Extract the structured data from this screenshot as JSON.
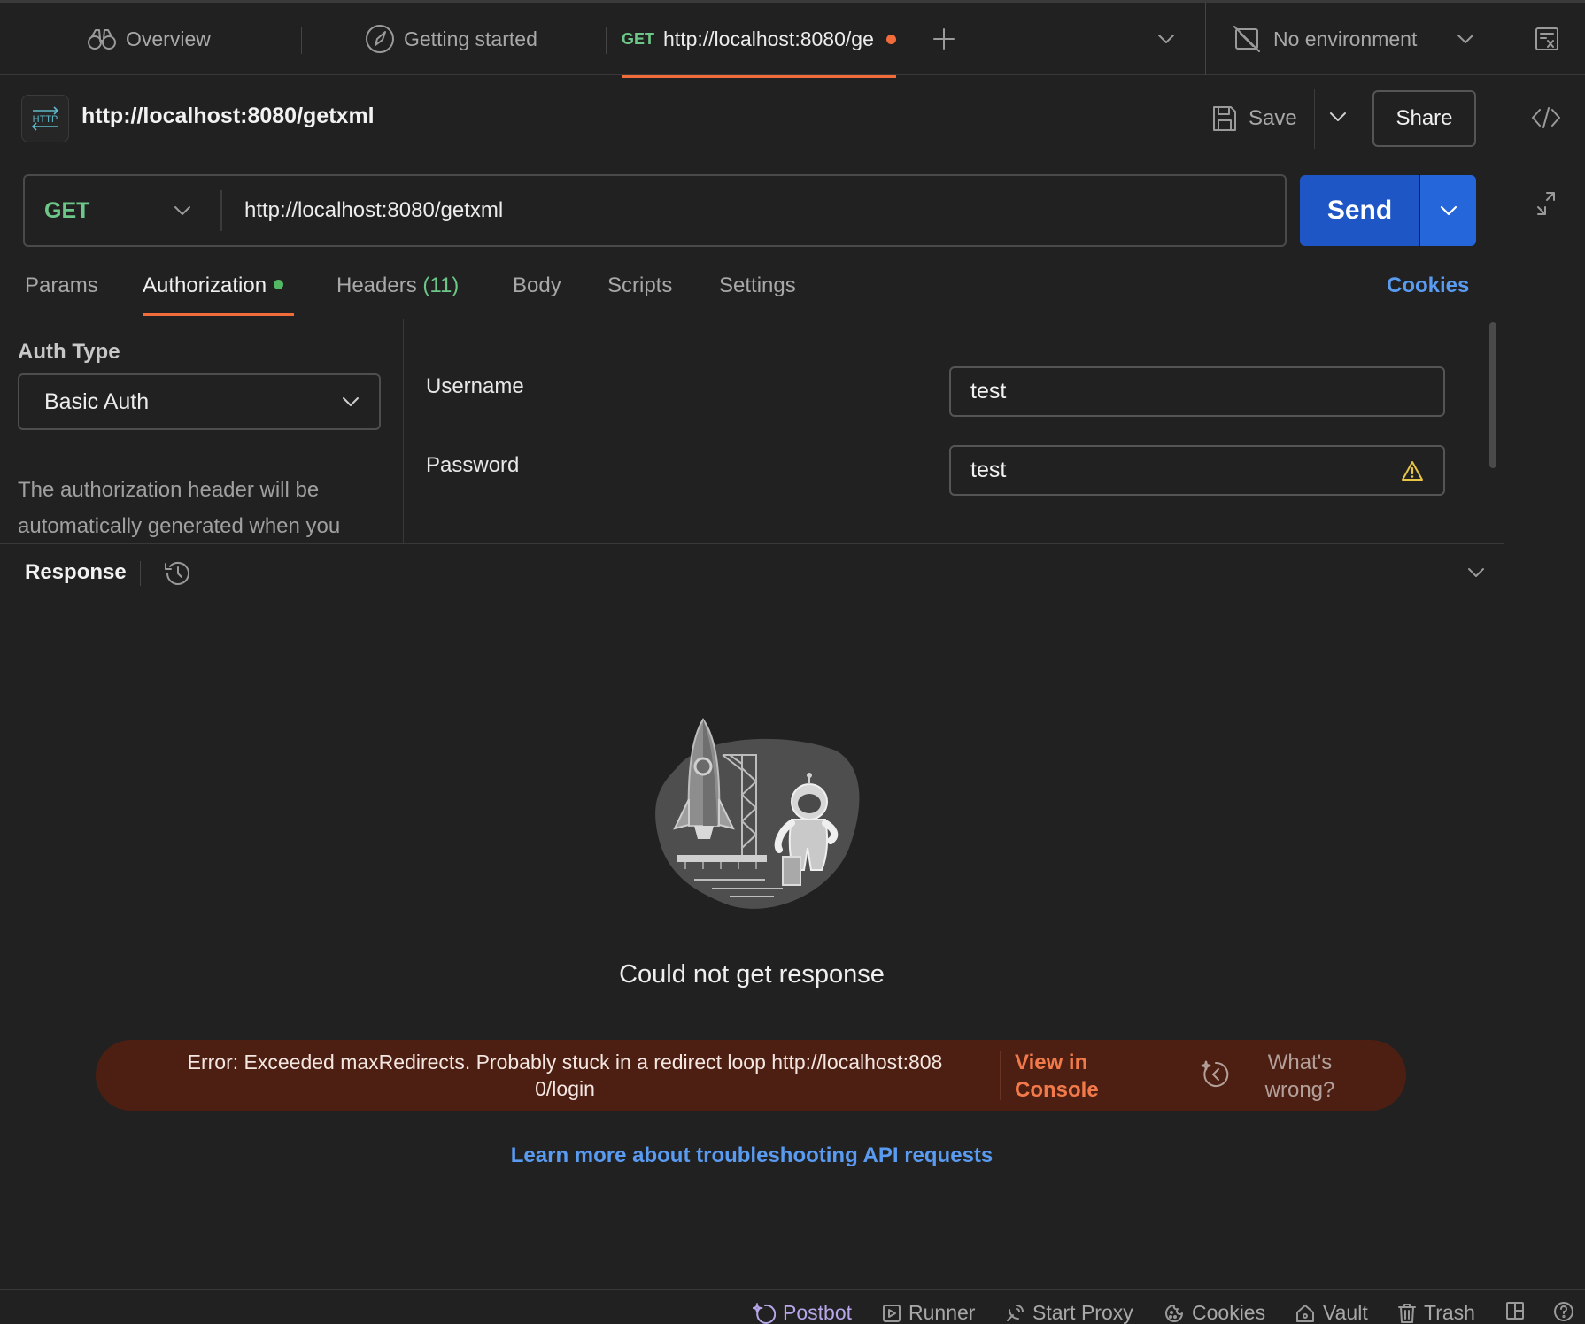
{
  "tabs": [
    {
      "label": "Overview",
      "icon": "binoculars-icon"
    },
    {
      "label": "Getting started",
      "icon": "compass-icon"
    },
    {
      "method": "GET",
      "label": "http://localhost:8080/gе",
      "unsaved": true,
      "active": true
    }
  ],
  "environment": {
    "label": "No environment"
  },
  "request": {
    "title": "http://localhost:8080/getxml",
    "badge": "HTTP",
    "method": "GET",
    "url": "http://localhost:8080/getxml",
    "save_label": "Save",
    "share_label": "Share",
    "send_label": "Send"
  },
  "request_tabs": {
    "params": "Params",
    "authorization": "Authorization",
    "headers": "Headers",
    "headers_count": "(11)",
    "body": "Body",
    "scripts": "Scripts",
    "settings": "Settings",
    "cookies": "Cookies"
  },
  "auth": {
    "type_label": "Auth Type",
    "type_value": "Basic Auth",
    "description": "The authorization header will be automatically generated when you",
    "username_label": "Username",
    "username_value": "test",
    "password_label": "Password",
    "password_value": "test"
  },
  "response": {
    "title": "Response",
    "empty_message": "Could not get response",
    "error_line1": "Error: Exceeded maxRedirects. Probably stuck in a redirect loop http://localhost:808",
    "error_line2": "0/login",
    "view_console": "View in Console",
    "whats_wrong": "What's wrong?",
    "learn_more": "Learn more about troubleshooting API requests"
  },
  "statusbar": {
    "postbot": "Postbot",
    "runner": "Runner",
    "start_proxy": "Start Proxy",
    "cookies": "Cookies",
    "vault": "Vault",
    "trash": "Trash"
  },
  "colors": {
    "background": "#212121",
    "accent_orange": "#f26b3a",
    "method_green": "#6cc788",
    "send_blue": "#1e56c5",
    "link_blue": "#5a9bf2",
    "error_bg": "#4d1f12"
  }
}
